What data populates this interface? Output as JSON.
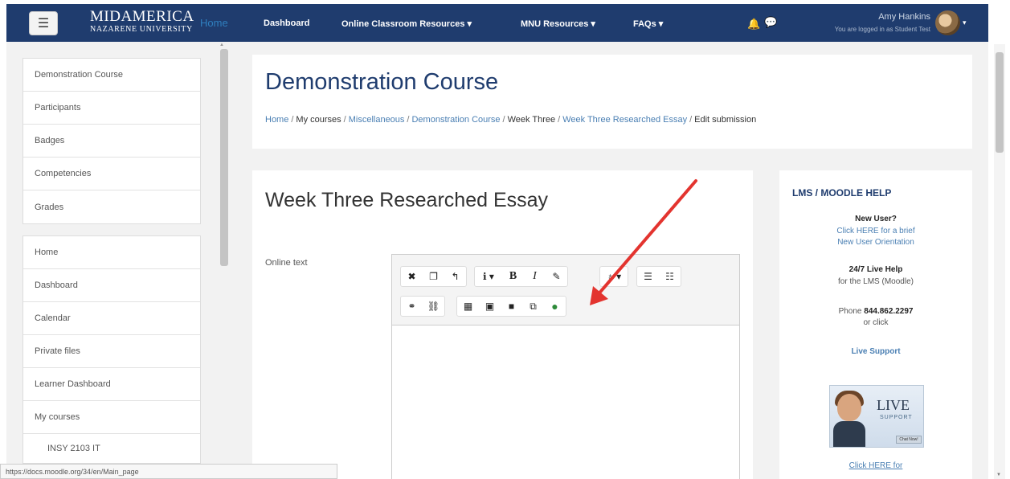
{
  "navbar": {
    "logo_line1": "MIDAMERICA",
    "logo_line2": "NAZARENE UNIVERSITY",
    "home_label": "Home",
    "items": [
      {
        "label": "Dashboard"
      },
      {
        "label": "Online Classroom Resources ▾"
      },
      {
        "label": "MNU Resources ▾"
      },
      {
        "label": "FAQs ▾"
      }
    ],
    "user_name": "Amy Hankins",
    "user_sub": "You are logged in as Student Test",
    "colors": {
      "bar": "#1f3c6e",
      "accent": "#2f7fbf"
    }
  },
  "left_nav": {
    "course_block": [
      {
        "label": "Demonstration Course"
      },
      {
        "label": "Participants"
      },
      {
        "label": "Badges"
      },
      {
        "label": "Competencies"
      },
      {
        "label": "Grades"
      }
    ],
    "site_block": [
      {
        "label": "Home"
      },
      {
        "label": "Dashboard"
      },
      {
        "label": "Calendar"
      },
      {
        "label": "Private files"
      },
      {
        "label": "Learner Dashboard"
      },
      {
        "label": "My courses"
      },
      {
        "label": "INSY 2103 IT"
      }
    ]
  },
  "header": {
    "course_title": "Demonstration Course",
    "breadcrumb": [
      {
        "label": "Home",
        "link": true
      },
      {
        "label": "My courses",
        "link": false
      },
      {
        "label": "Miscellaneous",
        "link": true
      },
      {
        "label": "Demonstration Course",
        "link": true
      },
      {
        "label": "Week Three",
        "link": false
      },
      {
        "label": "Week Three Researched Essay",
        "link": true
      },
      {
        "label": "Edit submission",
        "link": false
      }
    ]
  },
  "main": {
    "assignment_title": "Week Three Researched Essay",
    "online_text_label": "Online text",
    "toolbar_row1": [
      {
        "icon": "fullscreen-icon",
        "glyph": "✖"
      },
      {
        "icon": "paste-icon",
        "glyph": "📋"
      },
      {
        "icon": "undo-icon",
        "glyph": "↰"
      },
      {
        "icon": "paragraph-style-icon",
        "glyph": "ℹ ▾"
      },
      {
        "icon": "bold-icon",
        "glyph": "B"
      },
      {
        "icon": "italic-icon",
        "glyph": "I"
      },
      {
        "icon": "text-color-icon",
        "glyph": "✎"
      },
      {
        "icon": "text-highlight-icon",
        "glyph": "♁ ▾"
      },
      {
        "icon": "unordered-list-icon",
        "glyph": "☰"
      },
      {
        "icon": "ordered-list-icon",
        "glyph": "☷"
      }
    ],
    "toolbar_row2": [
      {
        "icon": "link-icon",
        "glyph": "🔗"
      },
      {
        "icon": "unlink-icon",
        "glyph": "⛓"
      },
      {
        "icon": "embed-icon",
        "glyph": "▦"
      },
      {
        "icon": "image-icon",
        "glyph": "▣"
      },
      {
        "icon": "video-icon",
        "glyph": "■"
      },
      {
        "icon": "manage-files-icon",
        "glyph": "⧉"
      },
      {
        "icon": "record-audio-icon",
        "glyph": "●"
      }
    ]
  },
  "help": {
    "title": "LMS / MOODLE HELP",
    "new_user": "New User?",
    "click_here_line1": "Click HERE for a brief",
    "click_here_line2": "New User Orientation",
    "live_help": "24/7 Live Help",
    "for_lms": "for the LMS (Moodle)",
    "phone_prefix": "Phone",
    "phone": "844.862.2297",
    "or_click": "or click",
    "live_support": "Live Support",
    "live_img_title": "LIVE",
    "live_img_sub": "SUPPORT",
    "live_img_btn": "Chat Now!",
    "click_here_bottom": "Click HERE for"
  },
  "status_url": "https://docs.moodle.org/34/en/Main_page"
}
